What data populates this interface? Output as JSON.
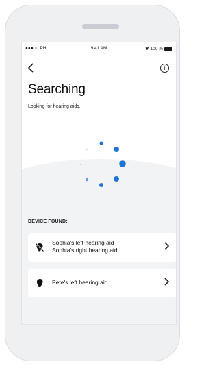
{
  "status_bar": {
    "carrier": "●●●○○ PH",
    "wifi_icon": "wifi-icon",
    "time": "9:41 AM",
    "bluetooth": "✱",
    "battery": "100 %"
  },
  "header": {
    "back_icon": "chevron-left-icon",
    "info_icon": "info-icon",
    "info_glyph": "i"
  },
  "page": {
    "title": "Searching",
    "subtitle": "Looking for hearing aids."
  },
  "spinner": {
    "state": "searching",
    "color": "#1f74d6"
  },
  "devices": {
    "section_label": "DEVICE FOUND:",
    "items": [
      {
        "icon": "hearing-aid-muted-icon",
        "line1": "Sophia's left hearing aid",
        "line2": "Sophia's right hearing aid"
      },
      {
        "icon": "hearing-aid-icon",
        "line1": "Pete's left hearing aid",
        "line2": ""
      }
    ]
  },
  "colors": {
    "accent": "#1f74d6",
    "background": "#f2f3f4",
    "card": "#ffffff"
  }
}
